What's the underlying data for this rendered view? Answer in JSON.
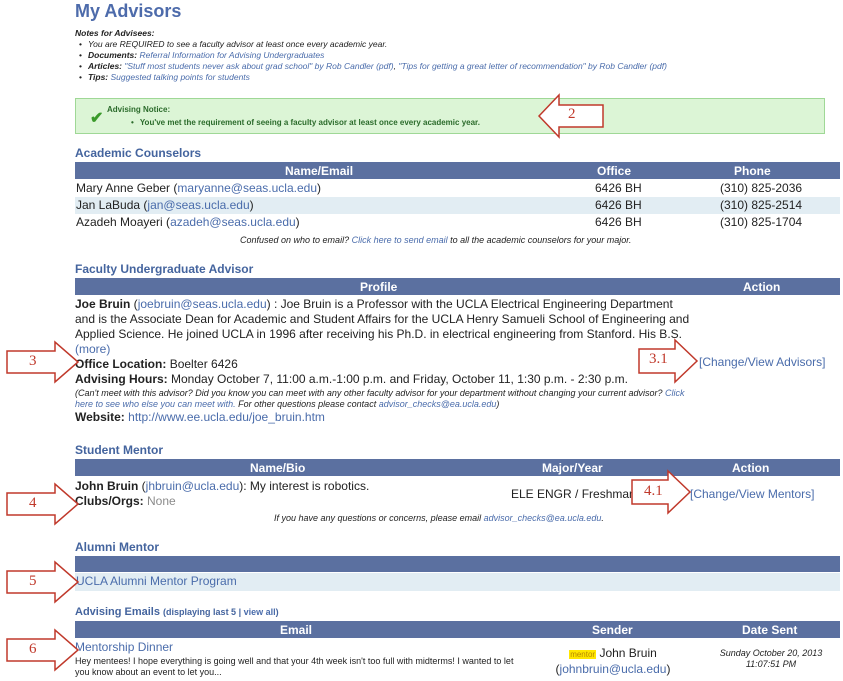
{
  "page_title": "My Advisors",
  "notes": {
    "heading": "Notes for Advisees:",
    "items": [
      {
        "text": "You are REQUIRED to see a faculty advisor at least once every academic year."
      },
      {
        "label": "Documents:",
        "link": "Referral Information for Advising Undergraduates"
      },
      {
        "label": "Articles:",
        "link1": "\"Stuff most students never ask about grad school\" by Rob Candler (pdf)",
        "sep": ", ",
        "link2": "\"Tips for getting a great letter of recommendation\" by Rob Candler (pdf)"
      },
      {
        "label": "Tips:",
        "link": "Suggested talking points for students"
      }
    ]
  },
  "notice": {
    "title": "Advising Notice:",
    "message": "You've met the requirement of seeing a faculty advisor at least once every academic year."
  },
  "callouts": {
    "c2": "2",
    "c3": "3",
    "c3_1": "3.1",
    "c4": "4",
    "c4_1": "4.1",
    "c5": "5",
    "c6": "6"
  },
  "counselors": {
    "title": "Academic Counselors",
    "headers": {
      "name": "Name/Email",
      "office": "Office",
      "phone": "Phone"
    },
    "rows": [
      {
        "name": "Mary Anne Geber",
        "email": "maryanne@seas.ucla.edu",
        "office": "6426 BH",
        "phone": "(310) 825-2036"
      },
      {
        "name": "Jan LaBuda",
        "email": "jan@seas.ucla.edu",
        "office": "6426 BH",
        "phone": "(310) 825-2514"
      },
      {
        "name": "Azadeh Moayeri",
        "email": "azadeh@seas.ucla.edu",
        "office": "6426 BH",
        "phone": "(310) 825-1704"
      }
    ],
    "footer_pre": "Confused on who to email?",
    "footer_link": "Click here to send email",
    "footer_post": "to all the academic counselors for your major."
  },
  "faculty": {
    "title": "Faculty Undergraduate Advisor",
    "headers": {
      "profile": "Profile",
      "action": "Action"
    },
    "name": "Joe Bruin",
    "email": "joebruin@seas.ucla.edu",
    "bio": ") : Joe Bruin is a Professor with the UCLA Electrical Engineering Department and is the Associate Dean for Academic and Student Affairs for the UCLA Henry Samueli School of Engineering and Applied Science. He joined UCLA in 1996 after receiving his Ph.D. in electrical engineering from Stanford. His B.S.",
    "more": "(more)",
    "office_label": "Office Location:",
    "office": "Boelter 6426",
    "hours_label": "Advising Hours:",
    "hours": "Monday October 7, 11:00 a.m.-1:00 p.m. and Friday, October 11, 1:30 p.m. - 2:30 p.m.",
    "note_pre": "(Can't meet with this advisor? Did you know you can meet with any other faculty advisor for your department without changing your current advisor?",
    "note_link": "Click here to see who else you can meet with.",
    "note_mid": "For other questions please contact",
    "note_email": "advisor_checks@ea.ucla.edu",
    "note_post": ")",
    "website_label": "Website:",
    "website": "http://www.ee.ucla.edu/joe_bruin.htm",
    "action": "[Change/View Advisors]"
  },
  "mentor": {
    "title": "Student Mentor",
    "headers": {
      "name": "Name/Bio",
      "major": "Major/Year",
      "action": "Action"
    },
    "name": "John Bruin",
    "email": "jhbruin@ucla.edu",
    "bio": "): My interest is robotics.",
    "clubs_label": "Clubs/Orgs:",
    "clubs": "None",
    "major": "ELE ENGR / Freshman",
    "action": "[Change/View Mentors]",
    "footer_pre": "If you have any questions or concerns, please email",
    "footer_email": "advisor_checks@ea.ucla.edu",
    "footer_post": "."
  },
  "alumni": {
    "title": "Alumni Mentor",
    "program": "UCLA Alumni Mentor Program"
  },
  "emails": {
    "title": "Advising Emails",
    "sub_pre": "(displaying last 5 |",
    "view_all": "view all",
    "sub_post": ")",
    "headers": {
      "email": "Email",
      "sender": "Sender",
      "date": "Date Sent"
    },
    "subject": "Mentorship Dinner",
    "preview": "Hey mentees! I hope everything is going well and that your 4th week isn't too full with midterms! I wanted to let you know about an event to let you...",
    "sender_tag": "mentor",
    "sender_name": "John Bruin",
    "sender_email": "johnbruin@ucla.edu",
    "date": "Sunday October 20, 2013",
    "time": "11:07:51 PM"
  }
}
